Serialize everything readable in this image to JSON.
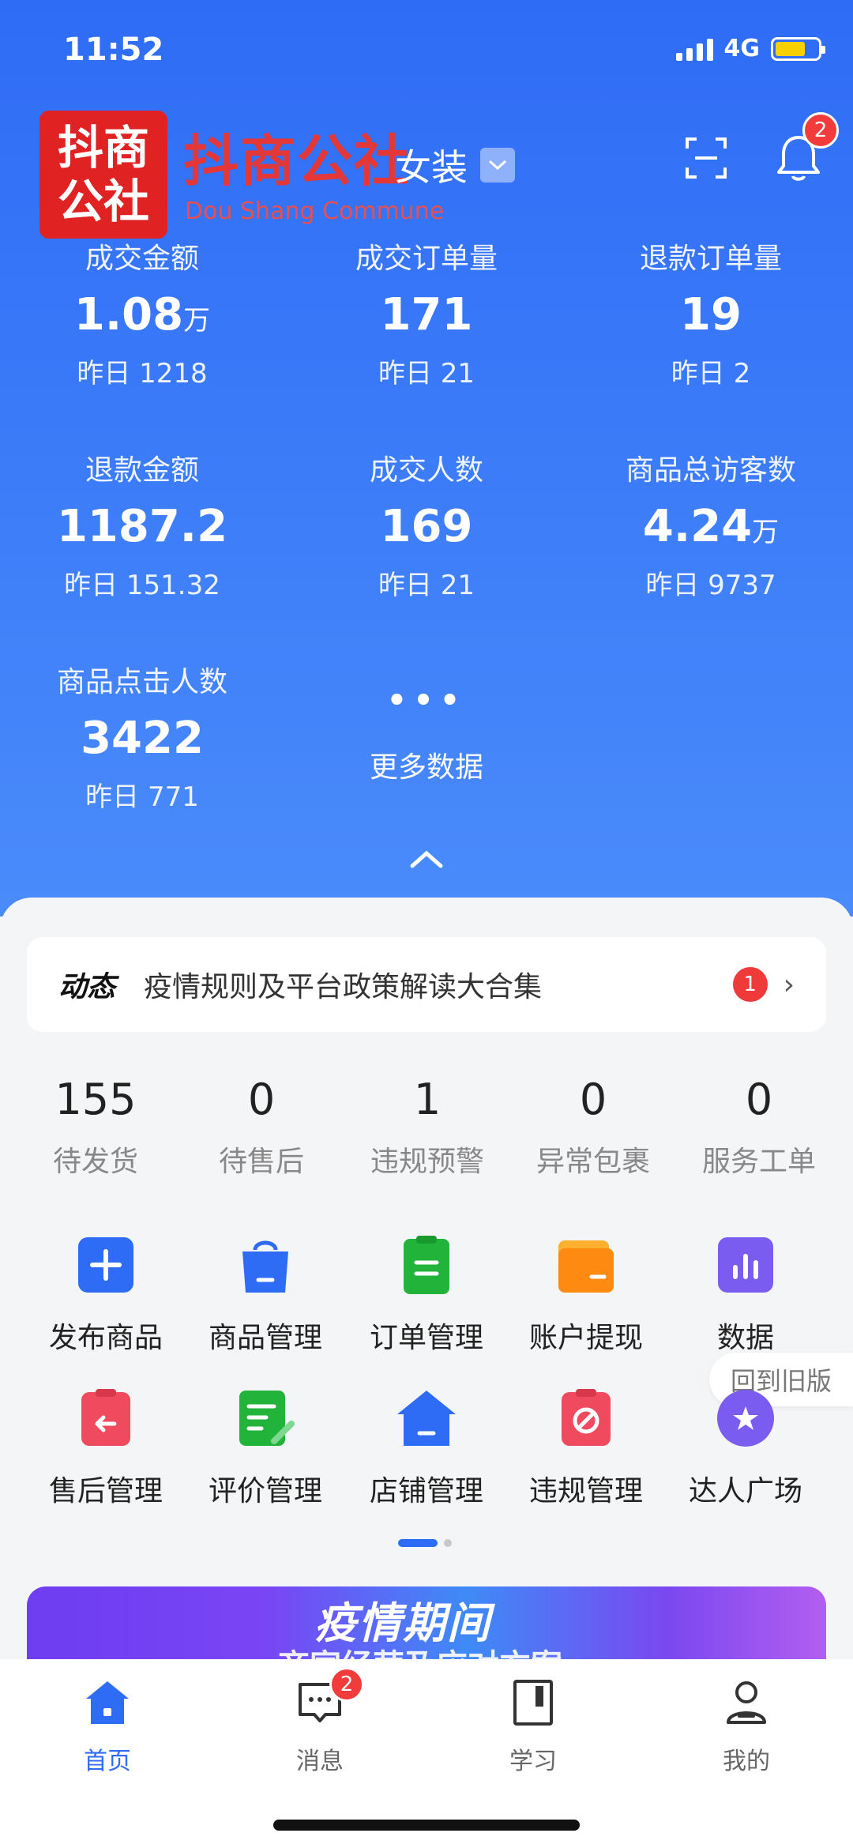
{
  "status_bar": {
    "time": "11:52",
    "network": "4G"
  },
  "watermark": {
    "logo_line1": "抖商",
    "logo_line2": "公社",
    "brand": "抖商公社",
    "brand_en": "Dou Shang Commune"
  },
  "header": {
    "store_name": "女装",
    "notification_count": "2",
    "icons": [
      "scan-icon",
      "bell-icon",
      "chevron-down-icon"
    ]
  },
  "stats": [
    {
      "label": "成交金额",
      "value": "1.08",
      "unit": "万",
      "prev": "昨日 1218"
    },
    {
      "label": "成交订单量",
      "value": "171",
      "unit": "",
      "prev": "昨日 21"
    },
    {
      "label": "退款订单量",
      "value": "19",
      "unit": "",
      "prev": "昨日 2"
    },
    {
      "label": "退款金额",
      "value": "1187.2",
      "unit": "",
      "prev": "昨日 151.32"
    },
    {
      "label": "成交人数",
      "value": "169",
      "unit": "",
      "prev": "昨日 21"
    },
    {
      "label": "商品总访客数",
      "value": "4.24",
      "unit": "万",
      "prev": "昨日 9737"
    },
    {
      "label": "商品点击人数",
      "value": "3422",
      "unit": "",
      "prev": "昨日 771"
    }
  ],
  "more_data": {
    "dots": "•••",
    "label": "更多数据"
  },
  "news": {
    "tag": "动态",
    "text": "疫情规则及平台政策解读大合集",
    "badge": "1",
    "arrow": "›"
  },
  "todos": [
    {
      "count": "155",
      "label": "待发货"
    },
    {
      "count": "0",
      "label": "待售后"
    },
    {
      "count": "1",
      "label": "违规预警"
    },
    {
      "count": "0",
      "label": "异常包裹"
    },
    {
      "count": "0",
      "label": "服务工单"
    }
  ],
  "tools": [
    {
      "label": "发布商品",
      "icon": "plus-icon",
      "color": "#2f6cf6"
    },
    {
      "label": "商品管理",
      "icon": "bag-icon",
      "color": "#2f6cf6"
    },
    {
      "label": "订单管理",
      "icon": "clipboard-icon",
      "color": "#22b33a"
    },
    {
      "label": "账户提现",
      "icon": "wallet-icon",
      "color": "#ff8a12"
    },
    {
      "label": "数据",
      "icon": "bar-chart-icon",
      "color": "#7b5cf0"
    },
    {
      "label": "售后管理",
      "icon": "return-icon",
      "color": "#f04a5e"
    },
    {
      "label": "评价管理",
      "icon": "review-icon",
      "color": "#22b33a"
    },
    {
      "label": "店铺管理",
      "icon": "store-icon",
      "color": "#2f6cf6"
    },
    {
      "label": "违规管理",
      "icon": "violation-icon",
      "color": "#f04a5e"
    },
    {
      "label": "达人广场",
      "icon": "star-icon",
      "color": "#7b5cf0"
    }
  ],
  "old_version": "回到旧版",
  "banner": {
    "title": "疫情期间",
    "subtitle": "商家经营及应对方案"
  },
  "tabbar": [
    {
      "label": "首页",
      "icon": "home-icon",
      "active": true
    },
    {
      "label": "消息",
      "icon": "message-icon",
      "badge": "2"
    },
    {
      "label": "学习",
      "icon": "book-icon"
    },
    {
      "label": "我的",
      "icon": "profile-icon"
    }
  ],
  "colors": {
    "primary": "#2f6cf6",
    "badge": "#f23b3b",
    "watermark": "#e02222"
  }
}
